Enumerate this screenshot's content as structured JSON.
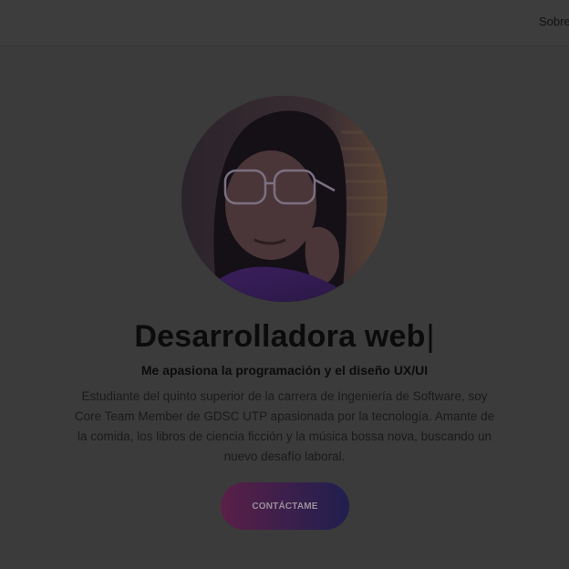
{
  "nav": {
    "links": [
      "Sobre"
    ]
  },
  "hero": {
    "headline": "Desarrolladora web",
    "cursor": "|",
    "subheadline": "Me apasiona la programación y el diseño UX/UI",
    "bio": "Estudiante del quinto superior de la carrera de Ingeniería de Software, soy Core Team Member de GDSC UTP apasionada por la tecnología. Amante de la comida, los libros de ciencia ficción y la música bossa nova, buscando un nuevo desafío laboral.",
    "cta_label": "CONTÁCTAME"
  },
  "colors": {
    "background": "#3b3b3b",
    "text": "#0b0b0b",
    "cta_gradient_start": "#5a1f47",
    "cta_gradient_end": "#1f1f4e"
  }
}
